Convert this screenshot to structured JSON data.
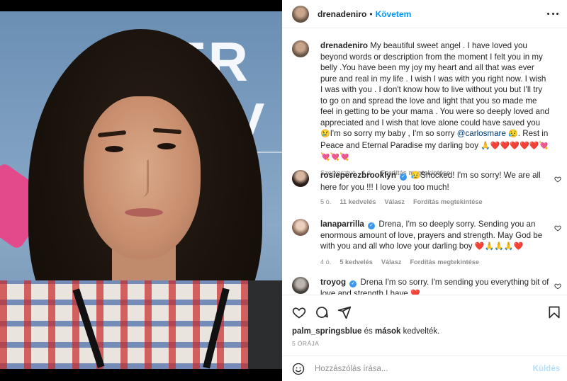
{
  "post": {
    "username": "drenadeniro",
    "follow_label": "Követem",
    "caption": {
      "username": "drenadeniro",
      "text_1": "My beautiful sweet angel . I have loved you beyond words or description from the moment I felt you in my belly .You have been my joy my heart and all that was ever pure and real in my life . I wish I was with you right now. I wish I was with you . I don't know how to live without you but I'll try to go on and spread the love and light that you so made me feel in getting to be your mama . You were so deeply loved and appreciated and I wish that love alone could have saved you ",
      "text_2": "I'm so sorry my baby , I'm so sorry ",
      "mention": "@carlosmare",
      "text_3": ". Rest in Peace and Eternal Paradise my darling boy ",
      "emoji_1": "😢",
      "emoji_2": "😥",
      "emoji_3": "🙏❤️❤️❤️❤️❤️💘💘💘💘",
      "meta_edited": "Szerkesztve",
      "meta_time": "4 ó.",
      "meta_translate": "Fordítás megtekintése"
    },
    "comments": [
      {
        "username": "rosieperezbrooklyn",
        "emoji": "😥",
        "text": "Shocked! I'm so sorry! We are all here for you !!! I love you too much!",
        "time": "5 ó.",
        "likes": "11 kedvelés",
        "reply": "Válasz",
        "translate": "Fordítás megtekintése"
      },
      {
        "username": "lanaparrilla",
        "text": "Drena, I'm so deeply sorry. Sending you an enormous amount of love, prayers and strength. May God be with you and all who love your darling boy ",
        "emoji": "❤️🙏🙏🙏❤️",
        "time": "4 ó.",
        "likes": "5 kedvelés",
        "reply": "Válasz",
        "translate": "Fordítás megtekintése"
      },
      {
        "username": "troyog",
        "text": "Drena I'm so sorry. I'm sending you everything bit of love and strength I have ",
        "emoji": "❤️"
      }
    ],
    "likes": {
      "user": "palm_springsblue",
      "connector": " és ",
      "others": "mások",
      "suffix": " kedvelték."
    },
    "time_ago": "5 ÓRÁJA",
    "comment_input": {
      "placeholder": "Hozzászólás írása..."
    },
    "post_label": "Küldés"
  },
  "photo": {
    "sign_line1": "TR E",
    "sign_line2": "T V"
  },
  "colors": {
    "accent": "#0095f6",
    "link": "#00376b",
    "meta": "#8e8e8e",
    "verified": "#3897f0"
  }
}
